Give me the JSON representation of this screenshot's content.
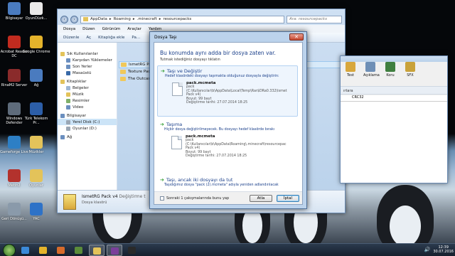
{
  "desktop": {
    "icons": [
      {
        "label": "Bilgisayar",
        "color": "#4a7bbf"
      },
      {
        "label": "OyunDüzk...",
        "color": "#e9e9e9"
      },
      {
        "label": "Acrobat Reader DC",
        "color": "#c22b1f"
      },
      {
        "label": "Google Chrome",
        "color": "#e4b32b"
      },
      {
        "label": "RinaM2 Server",
        "color": "#8a2b2b"
      },
      {
        "label": "Ağ",
        "color": "#4a7bbf"
      },
      {
        "label": "Windows Defender",
        "color": "#5e6b7b"
      },
      {
        "label": "Türk Telekom Pr...",
        "color": "#2c5ea8"
      },
      {
        "label": "Gameforge Live",
        "color": "#2d7fc5"
      },
      {
        "label": "Müzikler",
        "color": "#e3c35a"
      },
      {
        "label": "Metin2",
        "color": "#b3322d"
      },
      {
        "label": "Oyunlar",
        "color": "#e3c35a"
      },
      {
        "label": "Geri Dönüşü...",
        "color": "#8a9aaa"
      },
      {
        "label": "YAC",
        "color": "#2e72c7"
      }
    ]
  },
  "explorer": {
    "breadcrumb": [
      "AppData",
      "Roaming",
      ".minecraft",
      "resourcepacks"
    ],
    "search_placeholder": "Ara: resourcepacks",
    "menu": [
      "Dosya",
      "Düzen",
      "Görünüm",
      "Araçlar",
      "Yardım"
    ],
    "toolbar": [
      "Düzenle",
      "Aç",
      "Kitaplığa ekle",
      "Pa..."
    ],
    "nav": [
      {
        "label": "Sık Kullanılanlar",
        "type": "head",
        "color": "#e3c35a"
      },
      {
        "label": "Karşıdan Yüklemeler",
        "type": "item",
        "color": "#6b8fbf"
      },
      {
        "label": "Son Yerler",
        "type": "item",
        "color": "#6b8fbf"
      },
      {
        "label": "Masaüstü",
        "type": "item",
        "color": "#3a6aa8"
      },
      {
        "label": "Kitaplıklar",
        "type": "head",
        "color": "#e3c35a"
      },
      {
        "label": "Belgeler",
        "type": "item",
        "color": "#9db6d4"
      },
      {
        "label": "Müzik",
        "type": "item",
        "color": "#e3c35a"
      },
      {
        "label": "Resimler",
        "type": "item",
        "color": "#7fb06a"
      },
      {
        "label": "Video",
        "type": "item",
        "color": "#6b8fbf"
      },
      {
        "label": "Bilgisayar",
        "type": "head",
        "color": "#6b8fbf"
      },
      {
        "label": "Yerel Disk (C:)",
        "type": "sel",
        "color": "#9aa7b5"
      },
      {
        "label": "Oyunlar (D:)",
        "type": "item",
        "color": "#9aa7b5"
      },
      {
        "label": "Ağ",
        "type": "head",
        "color": "#6b8fbf"
      }
    ],
    "files": [
      {
        "label": "IsmetRG Pack",
        "sel": true
      },
      {
        "label": "Texture Pack",
        "sel": false
      },
      {
        "label": "The Outcast R",
        "sel": false
      }
    ],
    "details": {
      "name": "IsmetRG Pack v4",
      "modified": "Değiştirme t",
      "type": "Dosya klasörü"
    }
  },
  "winrar": {
    "tools": [
      "Test",
      "Açıklama",
      "Koru",
      "SFX"
    ],
    "tool_colors": [
      "#d8a73c",
      "#6e8fb6",
      "#3f7f3f",
      "#c9a23a"
    ],
    "title_fragment": "ırtara",
    "column": "CRC32"
  },
  "dialog": {
    "title": "Dosya Taşı",
    "close_glyph": "✕",
    "heading": "Bu konumda aynı adda bir dosya zaten var.",
    "subheading": "Tutmak istediğiniz dosyayı tıklatın",
    "options": {
      "replace": {
        "title": "Taşı ve Değiştir",
        "desc": "Hedef klasördeki dosyayı taşımakta olduğunuz dosyayla değiştirin:",
        "file": {
          "name": "pack.mcmeta",
          "lines": [
            "pack",
            "(C:\\Kullanıcılar\\b\\AppData\\Local\\Temp\\Rar$DRa0.332\\Ismet",
            "Pack v4)",
            "Boyut: 99 bayt",
            "Değiştirme tarihi: 27.07.2014 18:25"
          ]
        }
      },
      "skip": {
        "title": "Taşıma",
        "desc": "Hiçbir dosya değiştirilmeyecek. Bu dosyayı hedef klasörde bırakı",
        "file": {
          "name": "pack.mcmeta",
          "lines": [
            "pack",
            "(C:\\Kullanıcılar\\b\\AppData\\Roaming\\.minecraft\\resourcepac",
            "Pack v4)",
            "Boyut: 99 bayt",
            "Değiştirme tarihi: 27.07.2014 18:25"
          ]
        }
      },
      "keep_both": {
        "title": "Taşı, ancak iki dosyayı da tut",
        "desc": "Taşıdığımız dosya \"pack (2).mcmeta\" adıyla yeniden adlandırılacak"
      }
    },
    "checkbox_label": "Sonraki 1 çakışmalarında bunu yap",
    "skip_button": "Atla",
    "cancel_button": "İptal"
  },
  "taskbar": {
    "apps": [
      {
        "name": "ie",
        "color": "#3b8ad9",
        "active": false
      },
      {
        "name": "chrome",
        "color": "#e4b32b",
        "active": false
      },
      {
        "name": "media",
        "color": "#d66b2b",
        "active": false
      },
      {
        "name": "minecraft",
        "color": "#5b8c3a",
        "active": false
      },
      {
        "name": "explorer",
        "color": "#e3c35a",
        "active": true
      },
      {
        "name": "winrar",
        "color": "#7a3f9a",
        "active": true
      },
      {
        "name": "cmd",
        "color": "#2a2a2a",
        "active": false
      }
    ],
    "time": "12:39",
    "date": "30.07.2016"
  }
}
